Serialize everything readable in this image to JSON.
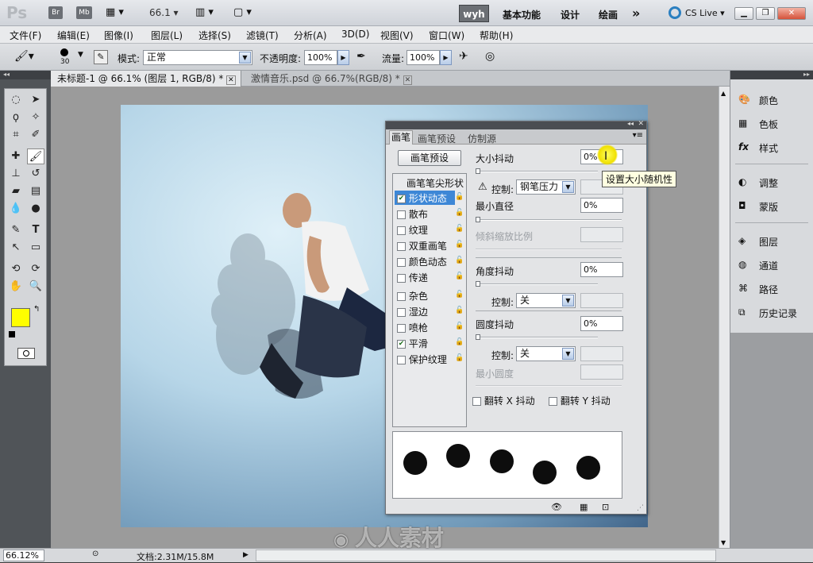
{
  "app": {
    "logo": "Ps",
    "zoom_select": "66.1",
    "workspace_active": "wyh",
    "workspaces": [
      "基本功能",
      "设计",
      "绘画"
    ],
    "more": "»",
    "cslive": "CS Live"
  },
  "menu": [
    "文件(F)",
    "编辑(E)",
    "图像(I)",
    "图层(L)",
    "选择(S)",
    "滤镜(T)",
    "分析(A)",
    "3D(D)",
    "视图(V)",
    "窗口(W)",
    "帮助(H)"
  ],
  "options": {
    "brush_size": "30",
    "mode_label": "模式:",
    "mode_value": "正常",
    "opacity_label": "不透明度:",
    "opacity_value": "100%",
    "flow_label": "流量:",
    "flow_value": "100%"
  },
  "tabs": [
    {
      "label": "未标题-1 @ 66.1% (图层 1, RGB/8) *",
      "active": true
    },
    {
      "label": "激情音乐.psd @ 66.7%(RGB/8) *",
      "active": false
    }
  ],
  "brush_panel": {
    "tabs": [
      "画笔",
      "画笔预设",
      "仿制源"
    ],
    "preset_button": "画笔预设",
    "list_header": "画笔笔尖形状",
    "list": [
      {
        "label": "形状动态",
        "checked": true,
        "selected": true
      },
      {
        "label": "散布",
        "checked": false
      },
      {
        "label": "纹理",
        "checked": false
      },
      {
        "label": "双重画笔",
        "checked": false
      },
      {
        "label": "颜色动态",
        "checked": false
      },
      {
        "label": "传递",
        "checked": false
      },
      {
        "label": "杂色",
        "checked": false
      },
      {
        "label": "湿边",
        "checked": false
      },
      {
        "label": "喷枪",
        "checked": false
      },
      {
        "label": "平滑",
        "checked": true
      },
      {
        "label": "保护纹理",
        "checked": false
      }
    ],
    "size_jitter_label": "大小抖动",
    "size_jitter_value": "0%",
    "tooltip": "设置大小随机性",
    "control_label": "控制:",
    "control1_value": "钢笔压力",
    "min_diameter_label": "最小直径",
    "min_diameter_value": "0%",
    "tilt_scale_label": "倾斜缩放比例",
    "angle_jitter_label": "角度抖动",
    "angle_jitter_value": "0%",
    "control2_value": "关",
    "roundness_jitter_label": "圆度抖动",
    "roundness_jitter_value": "0%",
    "control3_value": "关",
    "min_roundness_label": "最小圆度",
    "flip_x_label": "翻转 X 抖动",
    "flip_y_label": "翻转 Y 抖动"
  },
  "right_panels": [
    {
      "label": "颜色",
      "icon": "palette-icon"
    },
    {
      "label": "色板",
      "icon": "swatches-icon"
    },
    {
      "label": "样式",
      "icon": "fx-icon"
    },
    {
      "label": "调整",
      "icon": "adjust-icon"
    },
    {
      "label": "蒙版",
      "icon": "mask-icon"
    },
    {
      "label": "图层",
      "icon": "layers-icon"
    },
    {
      "label": "通道",
      "icon": "channels-icon"
    },
    {
      "label": "路径",
      "icon": "paths-icon"
    },
    {
      "label": "历史记录",
      "icon": "history-icon"
    }
  ],
  "status": {
    "zoom": "66.12%",
    "doc": "文档:2.31M/15.8M"
  },
  "watermark": "人人素材",
  "colors": {
    "foreground": "#ffff00",
    "background": "#ffffff",
    "workspace_btn": "#6b6f74"
  }
}
